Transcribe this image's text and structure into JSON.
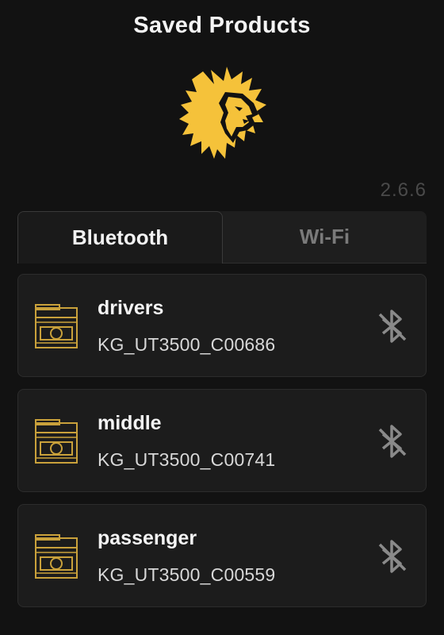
{
  "header": {
    "title": "Saved Products",
    "logo_icon": "lion-head-logo-icon",
    "version": "2.6.6"
  },
  "tabs": [
    {
      "label": "Bluetooth",
      "active": true
    },
    {
      "label": "Wi-Fi",
      "active": false
    }
  ],
  "devices": [
    {
      "name": "drivers",
      "id": "KG_UT3500_C00686",
      "icon": "device-unit-icon",
      "status_icon": "bluetooth-disabled-icon"
    },
    {
      "name": "middle",
      "id": "KG_UT3500_C00741",
      "icon": "device-unit-icon",
      "status_icon": "bluetooth-disabled-icon"
    },
    {
      "name": "passenger",
      "id": "KG_UT3500_C00559",
      "icon": "device-unit-icon",
      "status_icon": "bluetooth-disabled-icon"
    }
  ],
  "colors": {
    "background": "#121212",
    "card": "#1c1c1c",
    "accent": "#f5c23a",
    "icon_gold": "#c9a13b",
    "muted": "#7a7a7a"
  }
}
